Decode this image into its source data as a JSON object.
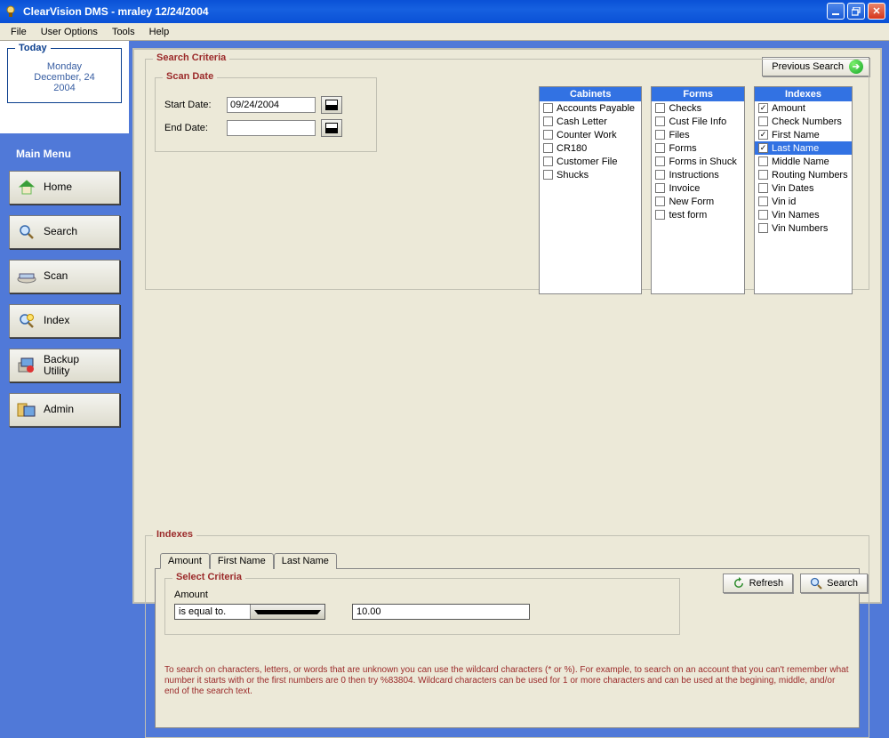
{
  "window": {
    "title": "ClearVision DMS - mraley 12/24/2004"
  },
  "menubar": [
    "File",
    "User Options",
    "Tools",
    "Help"
  ],
  "today": {
    "label": "Today",
    "line1": "Monday",
    "line2": "December, 24",
    "line3": "2004"
  },
  "main_menu": {
    "title": "Main Menu",
    "items": [
      {
        "label": "Home"
      },
      {
        "label": "Search"
      },
      {
        "label": "Scan"
      },
      {
        "label": "Index"
      },
      {
        "label": "Backup Utility"
      },
      {
        "label": "Admin"
      }
    ]
  },
  "previous_search": "Previous Search",
  "search_criteria": {
    "legend": "Search Criteria"
  },
  "scan_date": {
    "legend": "Scan Date",
    "start_label": "Start Date:",
    "start_value": "09/24/2004",
    "end_label": "End Date:",
    "end_value": ""
  },
  "lists": {
    "cabinets": {
      "header": "Cabinets",
      "items": [
        {
          "label": "Accounts Payable",
          "checked": false
        },
        {
          "label": "Cash Letter",
          "checked": false
        },
        {
          "label": "Counter Work",
          "checked": false
        },
        {
          "label": "CR180",
          "checked": false
        },
        {
          "label": "Customer File",
          "checked": false
        },
        {
          "label": "Shucks",
          "checked": false
        }
      ]
    },
    "forms": {
      "header": "Forms",
      "items": [
        {
          "label": "Checks",
          "checked": false
        },
        {
          "label": "Cust File Info",
          "checked": false
        },
        {
          "label": "Files",
          "checked": false
        },
        {
          "label": "Forms",
          "checked": false
        },
        {
          "label": "Forms in Shuck",
          "checked": false
        },
        {
          "label": "Instructions",
          "checked": false
        },
        {
          "label": "Invoice",
          "checked": false
        },
        {
          "label": "New Form",
          "checked": false
        },
        {
          "label": "test form",
          "checked": false
        }
      ]
    },
    "indexes": {
      "header": "Indexes",
      "items": [
        {
          "label": "Amount",
          "checked": true,
          "selected": false
        },
        {
          "label": "Check Numbers",
          "checked": false,
          "selected": false
        },
        {
          "label": "First Name",
          "checked": true,
          "selected": false
        },
        {
          "label": "Last Name",
          "checked": true,
          "selected": true
        },
        {
          "label": "Middle Name",
          "checked": false,
          "selected": false
        },
        {
          "label": "Routing Numbers",
          "checked": false,
          "selected": false
        },
        {
          "label": "Vin Dates",
          "checked": false,
          "selected": false
        },
        {
          "label": "Vin id",
          "checked": false,
          "selected": false
        },
        {
          "label": "Vin Names",
          "checked": false,
          "selected": false
        },
        {
          "label": "Vin Numbers",
          "checked": false,
          "selected": false
        }
      ]
    }
  },
  "indexes_box": {
    "legend": "Indexes",
    "tabs": [
      "Amount",
      "First Name",
      "Last Name"
    ],
    "active_tab": 0,
    "select_criteria": {
      "legend": "Select Criteria",
      "field_label": "Amount",
      "operator": "is equal to.",
      "value": "10.00"
    },
    "hint": "To search on characters, letters, or words that are unknown you can use the wildcard characters (* or %). For example, to search on an account that you can't remember what number it starts with or the first numbers are 0 then try %83804. Wildcard characters can be used for 1 or more characters and can be used at the begining, middle, and/or end of the search text."
  },
  "buttons": {
    "refresh": "Refresh",
    "search": "Search"
  }
}
